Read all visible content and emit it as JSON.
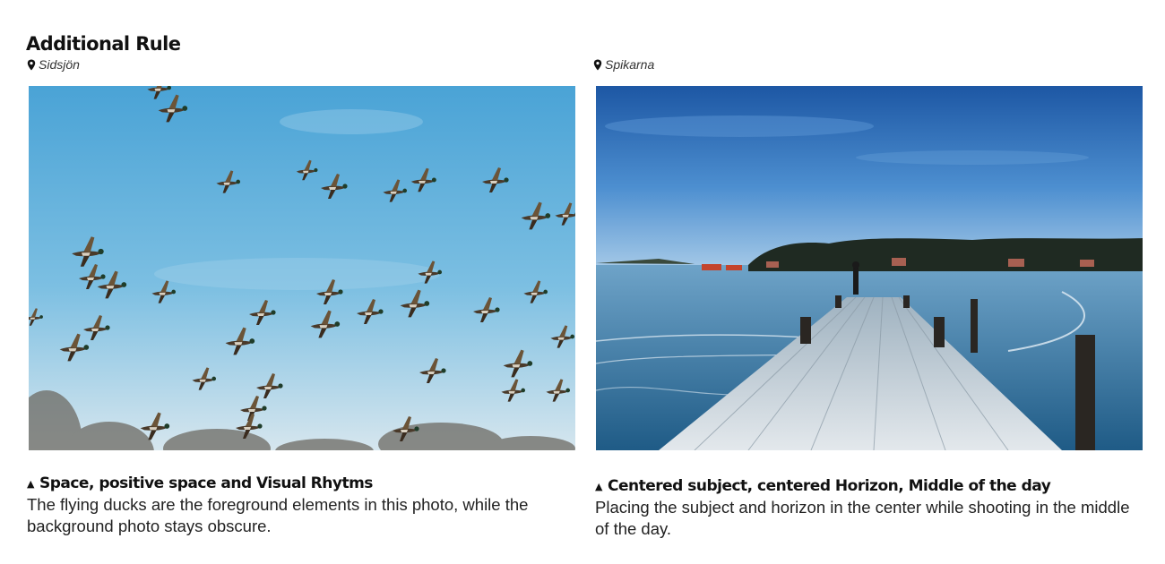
{
  "title": "Additional Rule",
  "panels": [
    {
      "location": "Sidsjön",
      "caption_title": "Space, positive space and Visual Rhytms",
      "caption_text": "The flying ducks are the foreground elements in this photo, while the background photo stays obscure."
    },
    {
      "location": "Spikarna",
      "caption_title": "Centered subject, centered Horizon, Middle of the day",
      "caption_text": "Placing the subject and horizon in the center while shooting in the middle of the day."
    }
  ],
  "icons": {
    "location": "map-pin-icon",
    "caption_marker": "triangle-up-icon"
  },
  "colors": {
    "sky_blue": "#6fb2d9",
    "deep_sky": "#1f5ea8",
    "water": "#2c6f9a",
    "dock": "#c9d2d8"
  }
}
